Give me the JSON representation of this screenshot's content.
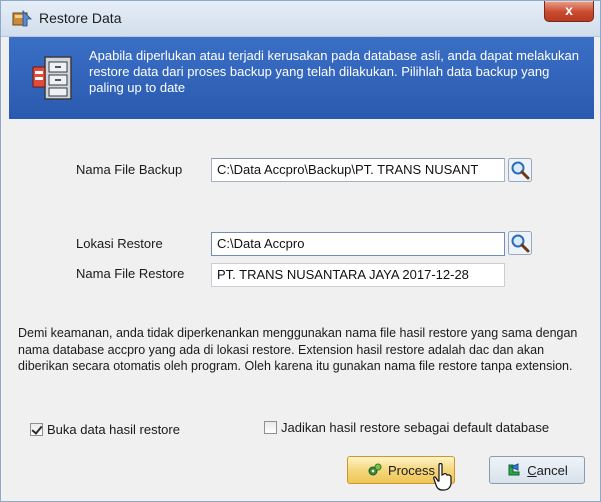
{
  "window": {
    "title": "Restore Data",
    "close_label": "x"
  },
  "banner": {
    "text": "Apabila diperlukan atau terjadi kerusakan pada database asli, anda dapat melakukan restore data dari proses backup yang telah dilakukan. Pilihlah data  backup yang paling up to date"
  },
  "form": {
    "backup_label": "Nama File Backup",
    "backup_value": "C:\\Data Accpro\\Backup\\PT. TRANS NUSANT",
    "restore_location_label": "Lokasi Restore",
    "restore_location_value": "C:\\Data Accpro",
    "restore_name_label": "Nama File Restore",
    "restore_name_value": "PT. TRANS NUSANTARA JAYA 2017-12-28"
  },
  "notice": "Demi keamanan, anda tidak diperkenankan menggunakan nama file hasil restore yang sama dengan nama database accpro yang ada di lokasi restore. Extension hasil restore adalah dac dan akan diberikan secara otomatis oleh program. Oleh karena itu gunakan nama file restore tanpa extension.",
  "options": {
    "open_result_label": "Buka data hasil restore",
    "open_result_checked": true,
    "default_db_label": "Jadikan hasil restore sebagai default database",
    "default_db_checked": false
  },
  "buttons": {
    "process_label": "Process",
    "cancel_label": "Cancel"
  },
  "colors": {
    "banner": "#2f62b8",
    "process_button": "#f5d77c"
  }
}
